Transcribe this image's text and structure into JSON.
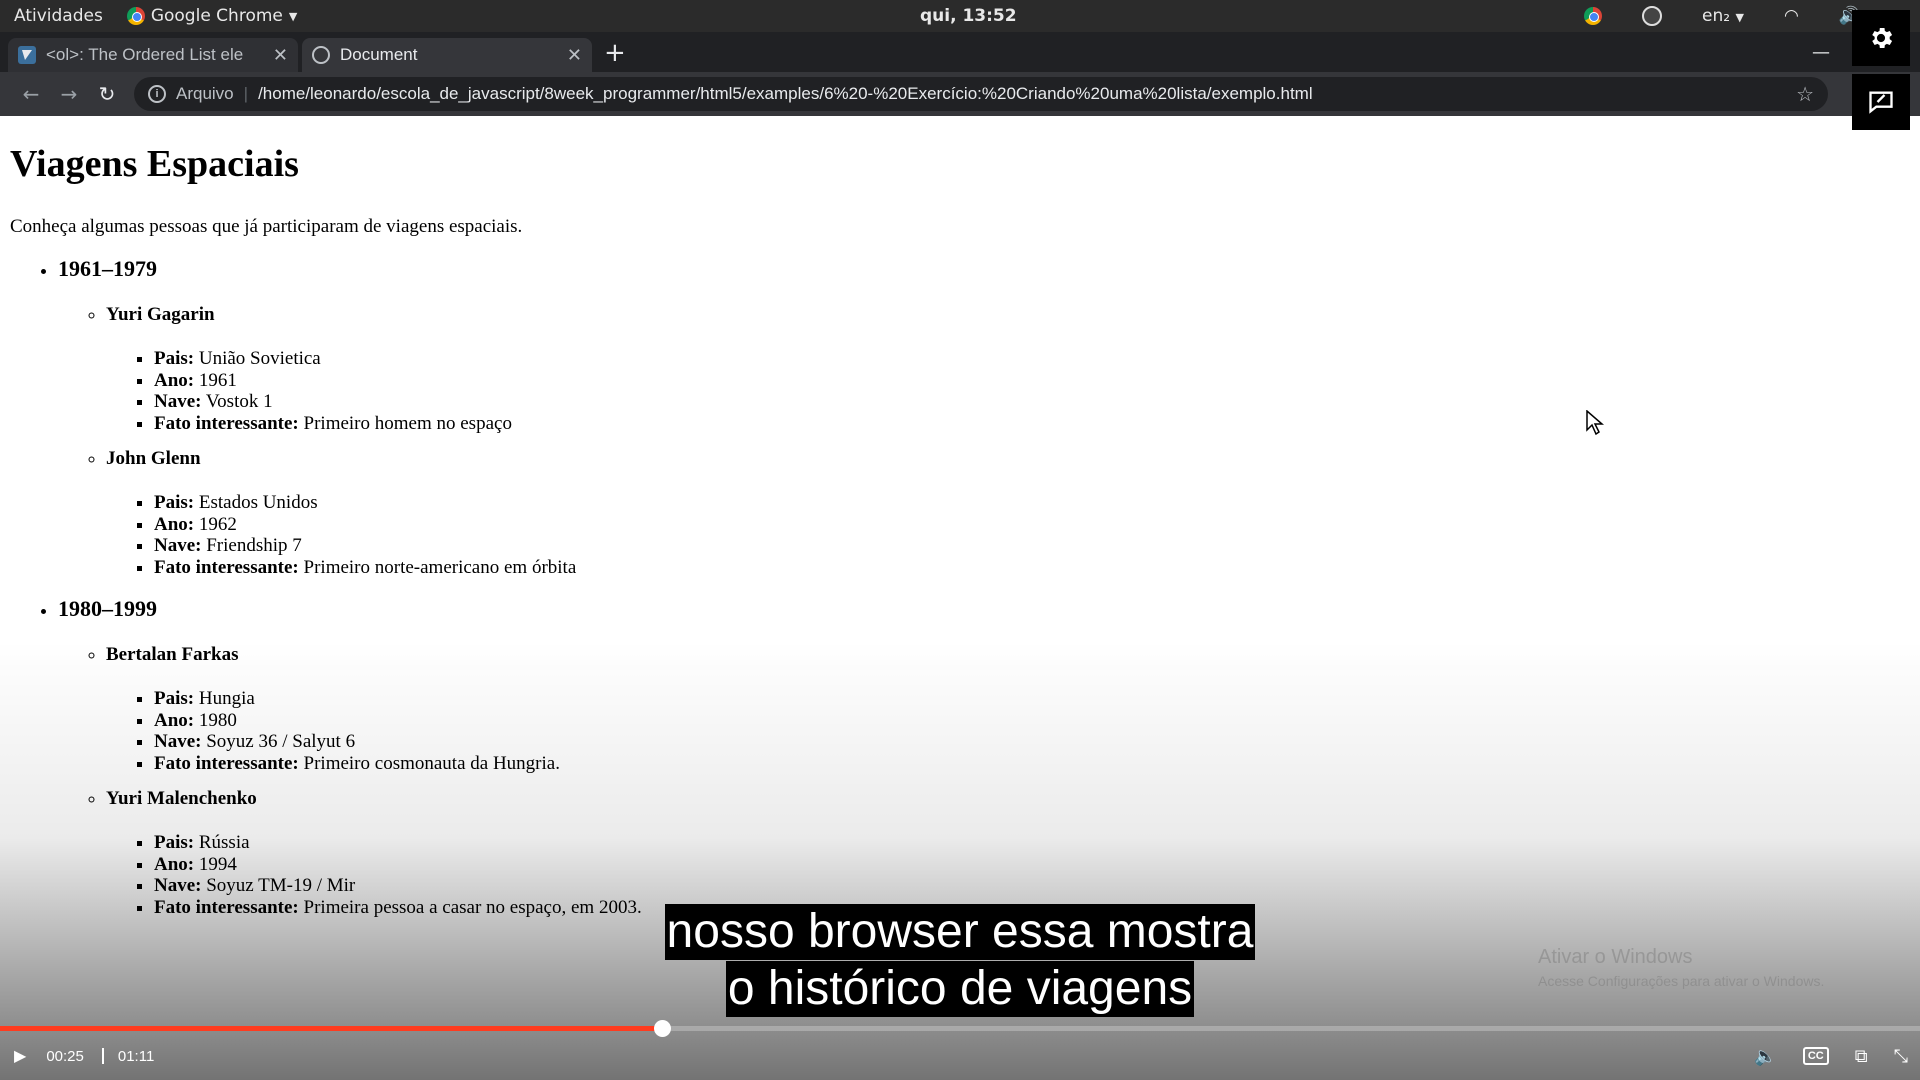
{
  "system_bar": {
    "activities": "Atividades",
    "app_name": "Google Chrome",
    "clock": "qui, 13:52",
    "keyboard_layout": "en₂"
  },
  "browser": {
    "tabs": [
      {
        "title": "<ol>: The Ordered List ele",
        "icon": "mdn-favicon-icon",
        "active": false
      },
      {
        "title": "Document",
        "icon": "globe-icon",
        "active": true
      }
    ],
    "address": {
      "scheme_label": "Arquivo",
      "url": "/home/leonardo/escola_de_javascript/8week_programmer/html5/examples/6%20-%20Exercício:%20Criando%20uma%20lista/exemplo.html"
    }
  },
  "page": {
    "title": "Viagens Espaciais",
    "intro": "Conheça algumas pessoas que já participaram de viagens espaciais.",
    "eras": [
      {
        "label": "1961–1979",
        "people": [
          {
            "name": "Yuri Gagarin",
            "facts": [
              {
                "key": "Pais:",
                "value": "União Sovietica"
              },
              {
                "key": "Ano:",
                "value": "1961"
              },
              {
                "key": "Nave:",
                "value": "Vostok 1"
              },
              {
                "key": "Fato interessante:",
                "value": "Primeiro homem no espaço"
              }
            ]
          },
          {
            "name": "John Glenn",
            "facts": [
              {
                "key": "Pais:",
                "value": "Estados Unidos"
              },
              {
                "key": "Ano:",
                "value": "1962"
              },
              {
                "key": "Nave:",
                "value": "Friendship 7"
              },
              {
                "key": "Fato interessante:",
                "value": "Primeiro norte-americano em órbita"
              }
            ]
          }
        ]
      },
      {
        "label": "1980–1999",
        "people": [
          {
            "name": "Bertalan Farkas",
            "facts": [
              {
                "key": "Pais:",
                "value": "Hungia"
              },
              {
                "key": "Ano:",
                "value": "1980"
              },
              {
                "key": "Nave:",
                "value": "Soyuz 36 / Salyut 6"
              },
              {
                "key": "Fato interessante:",
                "value": "Primeiro cosmonauta da Hungria."
              }
            ]
          },
          {
            "name": "Yuri Malenchenko",
            "facts": [
              {
                "key": "Pais:",
                "value": "Rússia"
              },
              {
                "key": "Ano:",
                "value": "1994"
              },
              {
                "key": "Nave:",
                "value": "Soyuz TM-19 / Mir"
              },
              {
                "key": "Fato interessante:",
                "value": "Primeira pessoa a casar no espaço, em 2003."
              }
            ]
          }
        ]
      }
    ]
  },
  "watermark": {
    "line1": "Ativar o Windows",
    "line2": "Acesse Configurações para ativar o Windows."
  },
  "video": {
    "subtitle_lines": [
      "nosso browser essa mostra",
      "o histórico de viagens"
    ],
    "current_time": "00:25",
    "duration": "01:11",
    "progress_fraction": 0.345,
    "progress_color": "#ff3b1f"
  }
}
